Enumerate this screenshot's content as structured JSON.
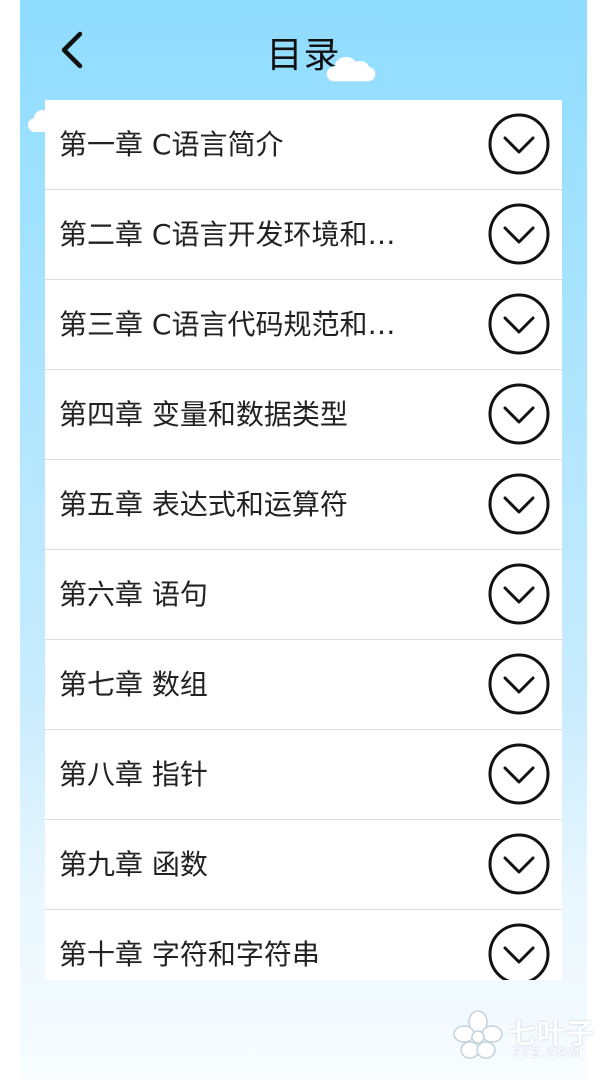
{
  "header": {
    "title": "目录",
    "back_icon": "chevron-left-icon"
  },
  "chapters": [
    {
      "label": "第一章 C语言简介"
    },
    {
      "label": "第二章 C语言开发环境和…"
    },
    {
      "label": "第三章 C语言代码规范和…"
    },
    {
      "label": "第四章 变量和数据类型"
    },
    {
      "label": "第五章 表达式和运算符"
    },
    {
      "label": "第六章 语句"
    },
    {
      "label": "第七章 数组"
    },
    {
      "label": "第八章 指针"
    },
    {
      "label": "第九章 函数"
    },
    {
      "label": "第十章 字符和字符串"
    }
  ],
  "expand_icon": "chevron-down-circle-icon",
  "watermark": {
    "text": "七叶子",
    "sub": "7YZ.COM"
  },
  "colors": {
    "sky_top": "#8fdcff",
    "sky_bottom": "#f8fcff",
    "text": "#222222",
    "divider": "#dddddd"
  }
}
